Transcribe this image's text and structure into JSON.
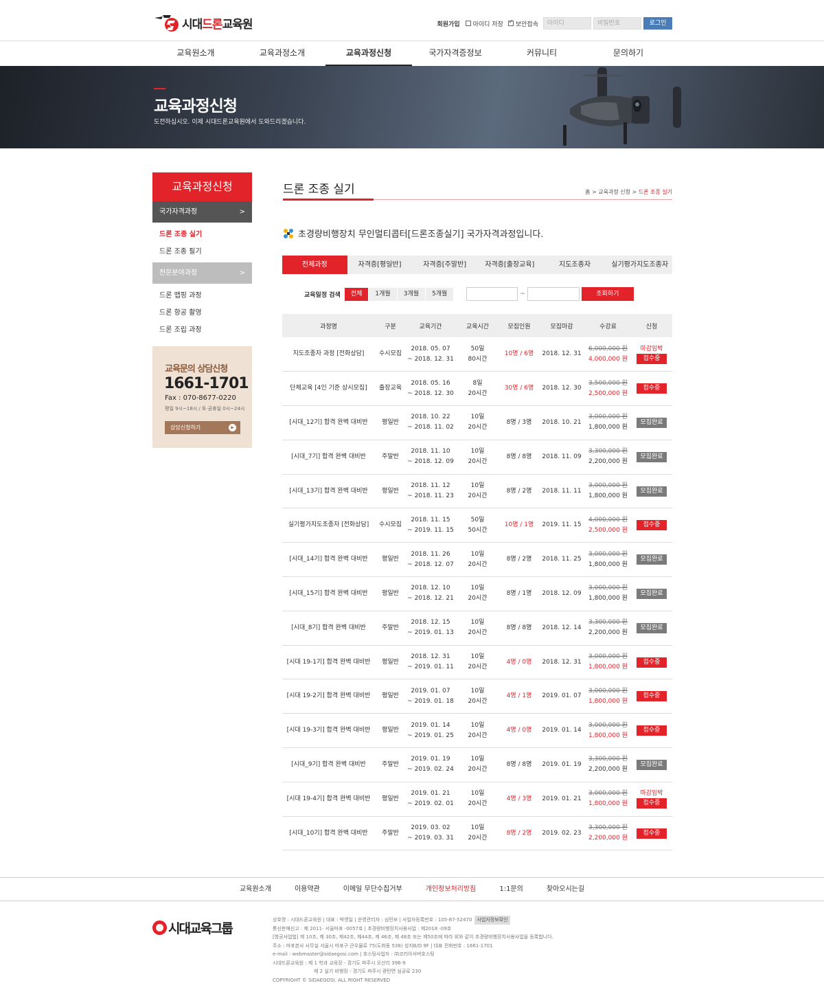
{
  "header": {
    "logo_text_a": "시대",
    "logo_text_b": "드론",
    "logo_text_c": "교육원",
    "join": "회원가입",
    "save_id": "아이디 저장",
    "secure": "보안접속",
    "id_placeholder": "아이디",
    "pw_placeholder": "비밀번호",
    "login": "로그인"
  },
  "nav": [
    "교육원소개",
    "교육과정소개",
    "교육과정신청",
    "국가자격증정보",
    "커뮤니티",
    "문의하기"
  ],
  "banner": {
    "title": "교육과정신청",
    "subtitle": "도전하십시오. 이제 시대드론교육원에서 도와드리겠습니다."
  },
  "sidebar": {
    "title": "교육과정신청",
    "cat1": "국가자격과정",
    "cat1_items": [
      "드론 조종 실기",
      "드론 조종 필기"
    ],
    "cat2": "전문분야과정",
    "cat2_items": [
      "드론 맵핑 과정",
      "드론 항공 촬영",
      "드론 조립 과정"
    ],
    "arrow": ">"
  },
  "consult": {
    "title": "교육문의 상담신청",
    "phone": "1661-1701",
    "fax": "Fax : 070-8677-0220",
    "hours": "평일 9시~18시 / 토·공휴일 0시~24시",
    "button": "상담신청하기"
  },
  "content": {
    "title": "드론 조종 실기",
    "breadcrumb_home": "홈",
    "breadcrumb_mid": "교육과정 신청",
    "breadcrumb_cur": "드론 조종 실기",
    "intro": "초경량비행장치 무인멀티콥터[드론조종실기] 국가자격과정입니다."
  },
  "tabs": [
    "전체과정",
    "자격증[평일반]",
    "자격증[주말반]",
    "자격증[출장교육]",
    "지도조종자",
    "실기평가지도조종자"
  ],
  "search": {
    "label": "교육일정 검색",
    "periods": [
      "전체",
      "1개월",
      "3개월",
      "5개월"
    ],
    "tilde": "~",
    "button": "조회하기"
  },
  "table": {
    "headers": [
      "과정명",
      "구분",
      "교육기간",
      "교육시간",
      "모집인원",
      "모집마감",
      "수강료",
      "신청"
    ],
    "rows": [
      {
        "name": "지도조종자 과정 [전화상담]",
        "type": "수시모집",
        "start": "2018. 05. 07",
        "end": "~ 2018. 12. 31",
        "days": "50일",
        "hours": "80시간",
        "people": "10명 / 6명",
        "people_red": true,
        "deadline": "2018. 12. 31",
        "orig": "6,000,000 원",
        "price": "4,000,000 원",
        "price_red": true,
        "note": "마감임박",
        "status": "접수중",
        "open": true
      },
      {
        "name": "단체교육 [4인 기준 상시모집]",
        "type": "출장교육",
        "start": "2018. 05. 16",
        "end": "~ 2018. 12. 30",
        "days": "8일",
        "hours": "20시간",
        "people": "30명 / 6명",
        "people_red": true,
        "deadline": "2018. 12. 30",
        "orig": "3,500,000 원",
        "price": "2,500,000 원",
        "price_red": true,
        "note": "",
        "status": "접수중",
        "open": true
      },
      {
        "name": "[시대_12기] 합격 완벽 대비반",
        "type": "평일반",
        "start": "2018. 10. 22",
        "end": "~ 2018. 11. 02",
        "days": "10일",
        "hours": "20시간",
        "people": "8명 / 3명",
        "people_red": false,
        "deadline": "2018. 10. 21",
        "orig": "3,000,000 원",
        "price": "1,800,000 원",
        "price_red": false,
        "note": "",
        "status": "모집완료",
        "open": false
      },
      {
        "name": "[시대_7기] 합격 완벽 대비반",
        "type": "주말반",
        "start": "2018. 11. 10",
        "end": "~ 2018. 12. 09",
        "days": "10일",
        "hours": "20시간",
        "people": "8명 / 8명",
        "people_red": false,
        "deadline": "2018. 11. 09",
        "orig": "3,300,000 원",
        "price": "2,200,000 원",
        "price_red": false,
        "note": "",
        "status": "모집완료",
        "open": false
      },
      {
        "name": "[시대_13기] 합격 완벽 대비반",
        "type": "평일반",
        "start": "2018. 11. 12",
        "end": "~ 2018. 11. 23",
        "days": "10일",
        "hours": "20시간",
        "people": "8명 / 2명",
        "people_red": false,
        "deadline": "2018. 11. 11",
        "orig": "3,000,000 원",
        "price": "1,800,000 원",
        "price_red": false,
        "note": "",
        "status": "모집완료",
        "open": false
      },
      {
        "name": "실기평가지도조종자 [전화상담]",
        "type": "수시모집",
        "start": "2018. 11. 15",
        "end": "~ 2019. 11. 15",
        "days": "50일",
        "hours": "50시간",
        "people": "10명 / 1명",
        "people_red": true,
        "deadline": "2019. 11. 15",
        "orig": "4,000,000 원",
        "price": "2,500,000 원",
        "price_red": true,
        "note": "",
        "status": "접수중",
        "open": true
      },
      {
        "name": "[시대_14기] 합격 완벽 대비반",
        "type": "평일반",
        "start": "2018. 11. 26",
        "end": "~ 2018. 12. 07",
        "days": "10일",
        "hours": "20시간",
        "people": "8명 / 2명",
        "people_red": false,
        "deadline": "2018. 11. 25",
        "orig": "3,000,000 원",
        "price": "1,800,000 원",
        "price_red": false,
        "note": "",
        "status": "모집완료",
        "open": false
      },
      {
        "name": "[시대_15기] 합격 완벽 대비반",
        "type": "평일반",
        "start": "2018. 12. 10",
        "end": "~ 2018. 12. 21",
        "days": "10일",
        "hours": "20시간",
        "people": "8명 / 1명",
        "people_red": false,
        "deadline": "2018. 12. 09",
        "orig": "3,000,000 원",
        "price": "1,800,000 원",
        "price_red": false,
        "note": "",
        "status": "모집완료",
        "open": false
      },
      {
        "name": "[시대_8기] 합격 완벽 대비반",
        "type": "주말반",
        "start": "2018. 12. 15",
        "end": "~ 2019. 01. 13",
        "days": "10일",
        "hours": "20시간",
        "people": "8명 / 8명",
        "people_red": false,
        "deadline": "2018. 12. 14",
        "orig": "3,300,000 원",
        "price": "2,200,000 원",
        "price_red": false,
        "note": "",
        "status": "모집완료",
        "open": false
      },
      {
        "name": "[시대 19-1기] 합격 완벽 대비반",
        "type": "평일반",
        "start": "2018. 12. 31",
        "end": "~ 2019. 01. 11",
        "days": "10일",
        "hours": "20시간",
        "people": "4명 / 0명",
        "people_red": true,
        "deadline": "2018. 12. 31",
        "orig": "3,000,000 원",
        "price": "1,800,000 원",
        "price_red": true,
        "note": "",
        "status": "접수중",
        "open": true
      },
      {
        "name": "[시대 19-2기] 합격 완벽 대비반",
        "type": "평일반",
        "start": "2019. 01. 07",
        "end": "~ 2019. 01. 18",
        "days": "10일",
        "hours": "20시간",
        "people": "4명 / 1명",
        "people_red": true,
        "deadline": "2019. 01. 07",
        "orig": "3,000,000 원",
        "price": "1,800,000 원",
        "price_red": true,
        "note": "",
        "status": "접수중",
        "open": true
      },
      {
        "name": "[시대 19-3기] 합격 완벽 대비반",
        "type": "평일반",
        "start": "2019. 01. 14",
        "end": "~ 2019. 01. 25",
        "days": "10일",
        "hours": "20시간",
        "people": "4명 / 0명",
        "people_red": true,
        "deadline": "2019. 01. 14",
        "orig": "3,000,000 원",
        "price": "1,800,000 원",
        "price_red": true,
        "note": "",
        "status": "접수중",
        "open": true
      },
      {
        "name": "[시대_9기] 합격 완벽 대비반",
        "type": "주말반",
        "start": "2019. 01. 19",
        "end": "~ 2019. 02. 24",
        "days": "10일",
        "hours": "20시간",
        "people": "8명 / 8명",
        "people_red": false,
        "deadline": "2019. 01. 19",
        "orig": "3,300,000 원",
        "price": "2,200,000 원",
        "price_red": false,
        "note": "",
        "status": "모집완료",
        "open": false
      },
      {
        "name": "[시대 19-4기] 합격 완벽 대비반",
        "type": "평일반",
        "start": "2019. 01. 21",
        "end": "~ 2019. 02. 01",
        "days": "10일",
        "hours": "20시간",
        "people": "4명 / 3명",
        "people_red": true,
        "deadline": "2019. 01. 21",
        "orig": "3,000,000 원",
        "price": "1,800,000 원",
        "price_red": true,
        "note": "마감임박",
        "status": "접수중",
        "open": true
      },
      {
        "name": "[시대_10기] 합격 완벽 대비반",
        "type": "주말반",
        "start": "2019. 03. 02",
        "end": "~ 2019. 03. 31",
        "days": "10일",
        "hours": "20시간",
        "people": "8명 / 2명",
        "people_red": true,
        "deadline": "2019. 02. 23",
        "orig": "3,300,000 원",
        "price": "2,200,000 원",
        "price_red": true,
        "note": "",
        "status": "접수중",
        "open": true
      }
    ]
  },
  "footer": {
    "nav": [
      "교육원소개",
      "이용약관",
      "이메일 무단수집거부",
      "개인정보처리방침",
      "1:1문의",
      "찾아오시는길"
    ],
    "nav_highlight": 3,
    "logo": "시대교육그룹",
    "info": [
      "상호명 : 시대드론교육원 | 대표 : 박영일 | 운영관리자 : 심민보 | 사업자등록번호 : 105-87-52470",
      "통신판매신고 : 제 2011- 서울마포 -0057호 | 초경량비행장치사용사업 : 제2018 -09호",
      "[항공사업법] 제 10조, 제 30조, 제42조, 제44조, 제 46조, 제 48조 또는 제50조에 따라 위와 같이 초경량비행장치사용사업을 등록합니다.",
      "주소 : 마포본사 사무실 서울시 마포구 큰우물로 75(도화동 538) 성지B/D 9F | 대표 전화번호 : 1661-1701",
      "e-mail : webmaster@sidaegosi.com | 호스팅사업자 : ㈜코리아서버호스팅",
      "시대드론교육원 : 제 1 학과 교육장 - 경기도 파주시 오산리 396-9",
      "제 2 실기 비행장 - 경기도 파주시 광탄면 심궁로 230",
      "COPYRIGHT © SIDAEGOSI. ALL RIGHT RESERVED"
    ],
    "biz_button": "사업자정보확인"
  }
}
